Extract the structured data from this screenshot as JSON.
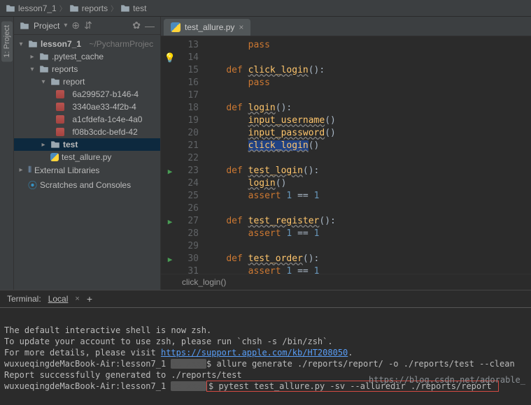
{
  "breadcrumbs": [
    "lesson7_1",
    "reports",
    "test"
  ],
  "sidebar_rail": {
    "label": "1: Project"
  },
  "project_panel": {
    "title": "Project",
    "tree": {
      "root": {
        "name": "lesson7_1",
        "hint": "~/PycharmProjec"
      },
      "pytest_cache": ".pytest_cache",
      "reports": "reports",
      "report": "report",
      "report_items": [
        "6a299527-b146-4",
        "3340ae33-4f2b-4",
        "a1cfdefa-1c4e-4a0",
        "f08b3cdc-befd-42"
      ],
      "test": "test",
      "test_file": "test_allure.py",
      "external": "External Libraries",
      "scratches": "Scratches and Consoles"
    }
  },
  "editor": {
    "tab": "test_allure.py",
    "status": "click_login()",
    "lines": [
      {
        "n": 13,
        "text": "        pass"
      },
      {
        "n": 14,
        "text": ""
      },
      {
        "n": 15,
        "text": "    def click_login():"
      },
      {
        "n": 16,
        "text": "        pass"
      },
      {
        "n": 17,
        "text": ""
      },
      {
        "n": 18,
        "text": "    def login():"
      },
      {
        "n": 19,
        "text": "        input_username()"
      },
      {
        "n": 20,
        "text": "        input_password()"
      },
      {
        "n": 21,
        "text": "        click_login()"
      },
      {
        "n": 22,
        "text": ""
      },
      {
        "n": 23,
        "text": "    def test_login():"
      },
      {
        "n": 24,
        "text": "        login()"
      },
      {
        "n": 25,
        "text": "        assert 1 == 1"
      },
      {
        "n": 26,
        "text": ""
      },
      {
        "n": 27,
        "text": "    def test_register():"
      },
      {
        "n": 28,
        "text": "        assert 1 == 1"
      },
      {
        "n": 29,
        "text": ""
      },
      {
        "n": 30,
        "text": "    def test_order():"
      },
      {
        "n": 31,
        "text": "        assert 1 == 1"
      }
    ],
    "run_markers": [
      23,
      27,
      30
    ]
  },
  "terminal": {
    "title": "Terminal:",
    "tab": "Local",
    "lines": {
      "l1": "The default interactive shell is now zsh.",
      "l2": "To update your account to use zsh, please run `chsh -s /bin/zsh`.",
      "l3_pre": "For more details, please visit ",
      "l3_link": "https://support.apple.com/kb/HT208050",
      "l3_post": ".",
      "l4_pre": "wuxueqingdeMacBook-Air:lesson7_1 ",
      "l4_cmd": "$ allure generate ./reports/report/ -o ./reports/test --clean",
      "l5": "Report successfully generated to ./reports/test",
      "l6_pre": "wuxueqingdeMacBook-Air:lesson7_1 ",
      "l6_cmd": "$ pytest test_allure.py -sv --alluredir ./reports/report "
    }
  },
  "watermark": "https://blog.csdn.net/adorable_"
}
